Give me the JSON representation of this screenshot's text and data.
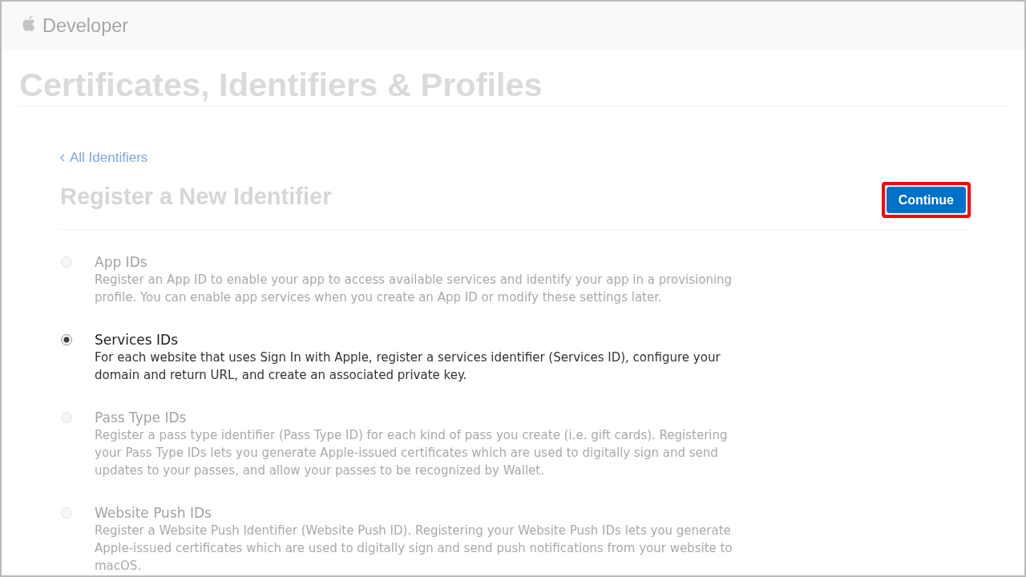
{
  "header": {
    "brand": "Developer"
  },
  "page_title": "Certificates, Identifiers & Profiles",
  "back_link": "All Identifiers",
  "heading": "Register a New Identifier",
  "continue_button": {
    "label": "Continue",
    "highlighted": true
  },
  "options": [
    {
      "title": "App IDs",
      "description": "Register an App ID to enable your app to access available services and identify your app in a provisioning profile. You can enable app services when you create an App ID or modify these settings later.",
      "selected": false,
      "dimmed": true
    },
    {
      "title": "Services IDs",
      "description": "For each website that uses Sign In with Apple, register a services identifier (Services ID), configure your domain and return URL, and create an associated private key.",
      "selected": true,
      "dimmed": false
    },
    {
      "title": "Pass Type IDs",
      "description": "Register a pass type identifier (Pass Type ID) for each kind of pass you create (i.e. gift cards). Registering your Pass Type IDs lets you generate Apple-issued certificates which are used to digitally sign and send updates to your passes, and allow your passes to be recognized by Wallet.",
      "selected": false,
      "dimmed": true
    },
    {
      "title": "Website Push IDs",
      "description": "Register a Website Push Identifier (Website Push ID). Registering your Website Push IDs lets you generate Apple-issued certificates which are used to digitally sign and send push notifications from your website to macOS.",
      "selected": false,
      "dimmed": true
    }
  ]
}
